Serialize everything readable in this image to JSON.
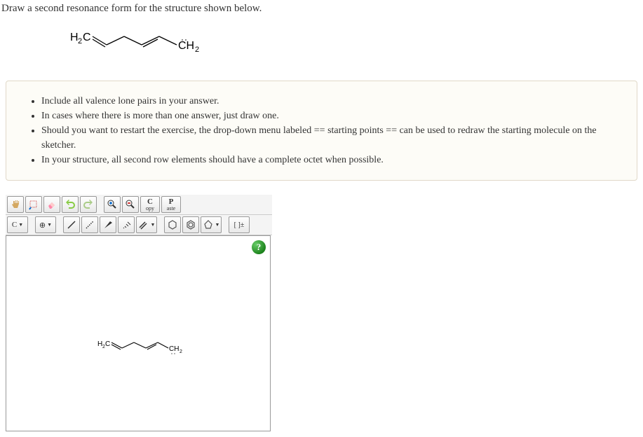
{
  "question": {
    "title": "Draw a second resonance form for the structure shown below.",
    "structure": {
      "left": "H₂C",
      "right": "C̈H₂"
    }
  },
  "instructions": [
    "Include all valence lone pairs in your answer.",
    "In cases where there is more than one answer, just draw one.",
    "Should you want to restart the exercise, the drop-down menu labeled == starting points == can be used to redraw the starting molecule on the sketcher.",
    "In your structure, all second row elements should have a complete octet when possible."
  ],
  "toolbar": {
    "row1": {
      "hand": "hand",
      "select": "select",
      "eraser": "eraser",
      "undo": "undo",
      "redo": "redo",
      "zoomin": "zoom-in",
      "zoomout": "zoom-out",
      "copy_top": "C",
      "copy_bot": "opy",
      "paste_top": "P",
      "paste_bot": "aste"
    },
    "row2": {
      "carbon": "C",
      "charge": "⊕",
      "single": "single-bond",
      "dashed": "dashed-bond",
      "wedge1": "wedge-bond",
      "wedge2": "wedge-hash-bond",
      "double": "double-bond",
      "hex1": "hexagon",
      "hex2": "benzene",
      "pent": "pentagon",
      "bracket": "[ ]±"
    }
  },
  "canvas": {
    "help": "?",
    "molecule_left": "H₂C",
    "molecule_right": "CH₂"
  }
}
